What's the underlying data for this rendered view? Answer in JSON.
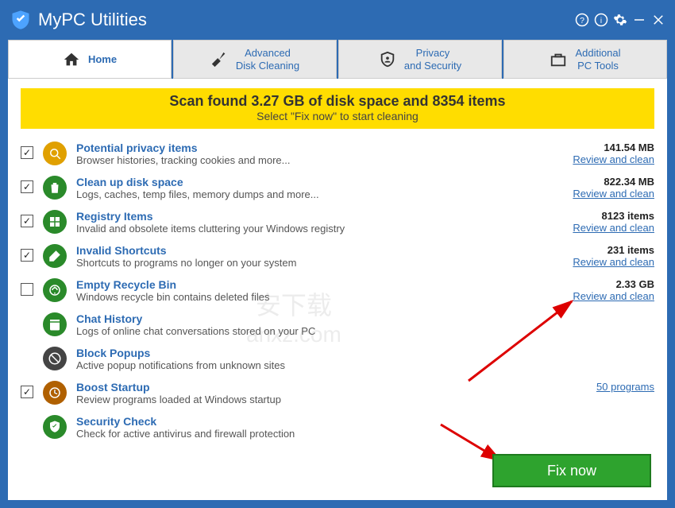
{
  "app": {
    "title": "MyPC Utilities"
  },
  "tabs": [
    {
      "label": "Home"
    },
    {
      "label": "Advanced\nDisk Cleaning"
    },
    {
      "label": "Privacy\nand Security"
    },
    {
      "label": "Additional\nPC Tools"
    }
  ],
  "banner": {
    "title": "Scan found 3.27 GB of disk space and 8354 items",
    "subtitle": "Select \"Fix now\" to start cleaning"
  },
  "items": [
    {
      "checked": true,
      "title": "Potential privacy items",
      "desc": "Browser histories, tracking cookies and more...",
      "stat": "141.54 MB",
      "link": "Review and clean"
    },
    {
      "checked": true,
      "title": "Clean up disk space",
      "desc": "Logs, caches, temp files, memory dumps and more...",
      "stat": "822.34 MB",
      "link": "Review and clean"
    },
    {
      "checked": true,
      "title": "Registry Items",
      "desc": "Invalid and obsolete items cluttering your Windows registry",
      "stat": "8123 items",
      "link": "Review and clean"
    },
    {
      "checked": true,
      "title": "Invalid Shortcuts",
      "desc": "Shortcuts to programs no longer on your system",
      "stat": "231 items",
      "link": "Review and clean"
    },
    {
      "checked": false,
      "title": "Empty Recycle Bin",
      "desc": "Windows recycle bin contains deleted files",
      "stat": "2.33 GB",
      "link": "Review and clean"
    },
    {
      "checked": null,
      "title": "Chat History",
      "desc": "Logs of online chat conversations stored on your PC",
      "stat": "",
      "link": ""
    },
    {
      "checked": null,
      "title": "Block Popups",
      "desc": "Active popup notifications from unknown sites",
      "stat": "",
      "link": ""
    },
    {
      "checked": true,
      "title": "Boost Startup",
      "desc": "Review programs loaded at Windows startup",
      "stat": "",
      "link": "50 programs"
    },
    {
      "checked": null,
      "title": "Security Check",
      "desc": "Check for active antivirus and firewall protection",
      "stat": "",
      "link": ""
    }
  ],
  "fix_button": "Fix now",
  "icon_colors": [
    "#e0a000",
    "#2a8a2a",
    "#2a8a2a",
    "#2a8a2a",
    "#2a8a2a",
    "#2a8a2a",
    "#444",
    "#b06000",
    "#2a8a2a"
  ],
  "watermark": {
    "top": "安下载",
    "bottom": "anxz.com"
  }
}
